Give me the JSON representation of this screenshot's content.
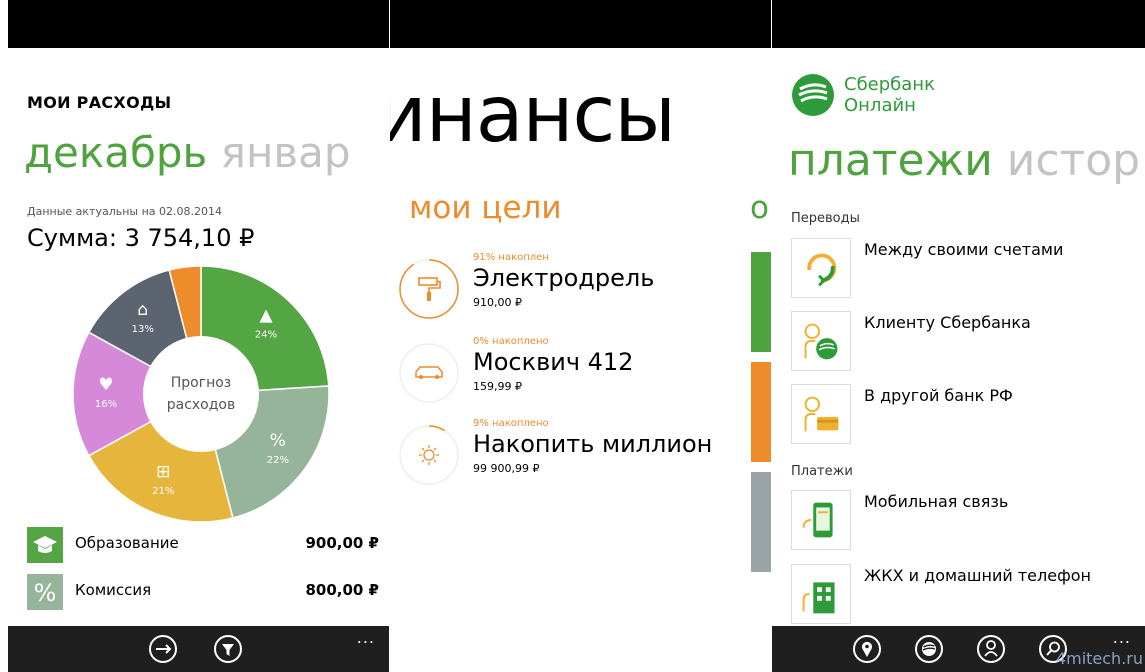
{
  "expenses": {
    "title": "МОИ РАСХОДЫ",
    "pivot_current": "декабрь",
    "pivot_next": "январ",
    "date_note": "Данные актуальны на 02.08.2014",
    "sum": "Сумма: 3 754,10 ₽",
    "chart_center_line1": "Прогноз",
    "chart_center_line2": "расходов",
    "categories": [
      {
        "label": "Образование",
        "amount": "900,00 ₽",
        "icon": "graduation-cap-icon",
        "color": "#54a543"
      },
      {
        "label": "Комиссия",
        "amount": "800,00 ₽",
        "icon": "percent-icon",
        "color": "#96b49a"
      }
    ]
  },
  "chart_data": {
    "type": "pie",
    "title": "",
    "slices": [
      {
        "value": 24,
        "label": "24%",
        "icon": "graduation-cap-icon",
        "color": "#54a543"
      },
      {
        "value": 22,
        "label": "22%",
        "icon": "percent-icon",
        "color": "#96b49a"
      },
      {
        "value": 21,
        "label": "21%",
        "icon": "cart-icon",
        "color": "#e6b63c"
      },
      {
        "value": 16,
        "label": "16%",
        "icon": "heart-icon",
        "color": "#d789d9"
      },
      {
        "value": 13,
        "label": "13%",
        "icon": "hanger-icon",
        "color": "#5c6470"
      },
      {
        "value": 4,
        "label": "",
        "icon": "",
        "color": "#ee8b2a"
      }
    ]
  },
  "finance": {
    "header": "инансы",
    "goals_title": "мои цели",
    "next_section_initial": "о",
    "goals": [
      {
        "pct_text": "91% накоплен",
        "pct": 91,
        "name": "Электродрель",
        "amount": "910,00 ₽",
        "icon": "paint-roller-icon"
      },
      {
        "pct_text": "0% накоплено",
        "pct": 0,
        "name": "Москвич 412",
        "amount": "159,99 ₽",
        "icon": "car-icon"
      },
      {
        "pct_text": "9% накоплено",
        "pct": 9,
        "name": "Накопить миллион",
        "amount": "99 900,99 ₽",
        "icon": "sun-icon"
      }
    ],
    "tile_colors": [
      "#4ea33f",
      "#ee8b2a",
      "#9aa3a6"
    ]
  },
  "sberbank": {
    "logo_line1": "Сбербанк",
    "logo_line2": "Онлайн",
    "pivot_current": "платежи",
    "pivot_next": "истор",
    "section_transfers": "Переводы",
    "section_payments": "Платежи",
    "transfers": [
      {
        "label": "Между своими счетами",
        "icon": "own-accounts-icon"
      },
      {
        "label": "Клиенту Сбербанка",
        "icon": "sberbank-client-icon"
      },
      {
        "label": "В другой банк РФ",
        "icon": "other-bank-icon"
      }
    ],
    "payments": [
      {
        "label": "Мобильная связь",
        "icon": "mobile-icon"
      },
      {
        "label": "ЖКХ и домашний телефон",
        "icon": "housing-icon"
      }
    ],
    "watermark": "4mitech.ru"
  },
  "appbar": {
    "more": "..."
  },
  "colors": {
    "accent_green": "#4ea33f",
    "accent_orange": "#ee8b2a",
    "appbar": "#1f1f1f"
  }
}
